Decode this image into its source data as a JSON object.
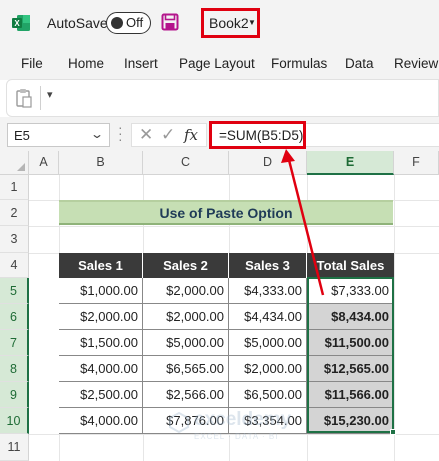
{
  "app": {
    "autosave_label": "AutoSave",
    "autosave_state": "Off",
    "workbook_name": "Book2",
    "excel_icon": "excel-logo-icon",
    "save_icon": "save-icon"
  },
  "menu": {
    "items": [
      "File",
      "Home",
      "Insert",
      "Page Layout",
      "Formulas",
      "Data",
      "Review"
    ]
  },
  "ribbon": {
    "paste_icon": "paste-icon",
    "qat_caret": "▾"
  },
  "formula_bar": {
    "name_box": "E5",
    "cancel": "✕",
    "enter": "✓",
    "fx": "fx",
    "formula": "=SUM(B5:D5)"
  },
  "grid": {
    "columns": [
      "A",
      "B",
      "C",
      "D",
      "E",
      "F"
    ],
    "rows": [
      "1",
      "2",
      "3",
      "4",
      "5",
      "6",
      "7",
      "8",
      "9",
      "10",
      "11"
    ],
    "selected_column": "E",
    "selected_rows": [
      "5",
      "6",
      "7",
      "8",
      "9",
      "10"
    ]
  },
  "sheet": {
    "title": "Use of Paste Option",
    "headers": [
      "Sales 1",
      "Sales 2",
      "Sales 3",
      "Total Sales"
    ],
    "rows": [
      [
        "$1,000.00",
        "$2,000.00",
        "$4,333.00",
        "$7,333.00"
      ],
      [
        "$2,000.00",
        "$2,000.00",
        "$4,434.00",
        "$8,434.00"
      ],
      [
        "$1,500.00",
        "$5,000.00",
        "$5,000.00",
        "$11,500.00"
      ],
      [
        "$4,000.00",
        "$6,565.00",
        "$2,000.00",
        "$12,565.00"
      ],
      [
        "$2,500.00",
        "$2,566.00",
        "$6,500.00",
        "$11,566.00"
      ],
      [
        "$4,000.00",
        "$7,876.00",
        "$3,354.00",
        "$15,230.00"
      ]
    ]
  },
  "watermark": {
    "name": "exceldemy",
    "tagline": "EXCEL · DATA · BI"
  },
  "colors": {
    "highlight_red": "#e00010",
    "excel_green": "#1e7145",
    "title_fill": "#c6dfb4",
    "header_fill": "#3a3a3a",
    "selected_fill": "#d4d4d4"
  }
}
